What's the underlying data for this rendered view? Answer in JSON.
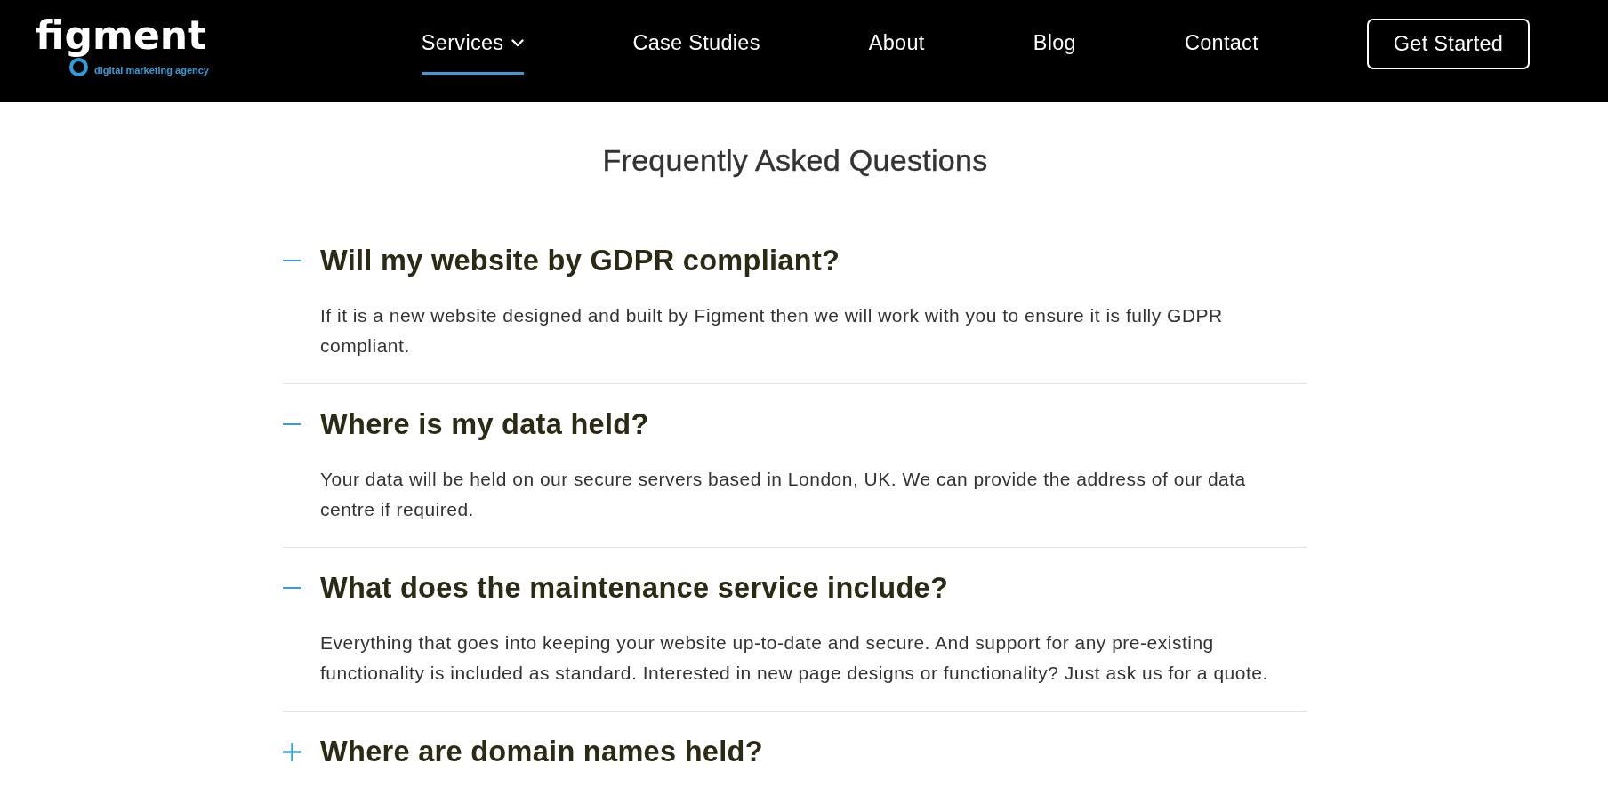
{
  "header": {
    "logo": {
      "wordmark": "figment",
      "tagline": "digital marketing agency"
    },
    "nav": [
      {
        "label": "Services",
        "selected": true,
        "dropdown": true
      },
      {
        "label": "Case Studies",
        "selected": false,
        "dropdown": false
      },
      {
        "label": "About",
        "selected": false,
        "dropdown": false
      },
      {
        "label": "Blog",
        "selected": false,
        "dropdown": false
      },
      {
        "label": "Contact",
        "selected": false,
        "dropdown": false
      }
    ],
    "cta_button": {
      "label": "Get Started"
    }
  },
  "faq": {
    "title": "Frequently Asked Questions",
    "items": [
      {
        "question": "Will my website by GDPR compliant?",
        "answer": "If it is a new website designed and built by Figment then we will work with you to ensure it is fully GDPR compliant.",
        "expanded": true
      },
      {
        "question": "Where is my data held?",
        "answer": "Your data will be held on our secure servers based in London, UK. We can provide the address of our data centre if required.",
        "expanded": true
      },
      {
        "question": "What does the maintenance service include?",
        "answer": "Everything that goes into keeping your website up-to-date and secure. And support for any pre-existing functionality is included as standard. Interested in new page designs or functionality? Just ask us for a quote.",
        "expanded": true
      },
      {
        "question": "Where are domain names held?",
        "expanded": false
      }
    ]
  }
}
